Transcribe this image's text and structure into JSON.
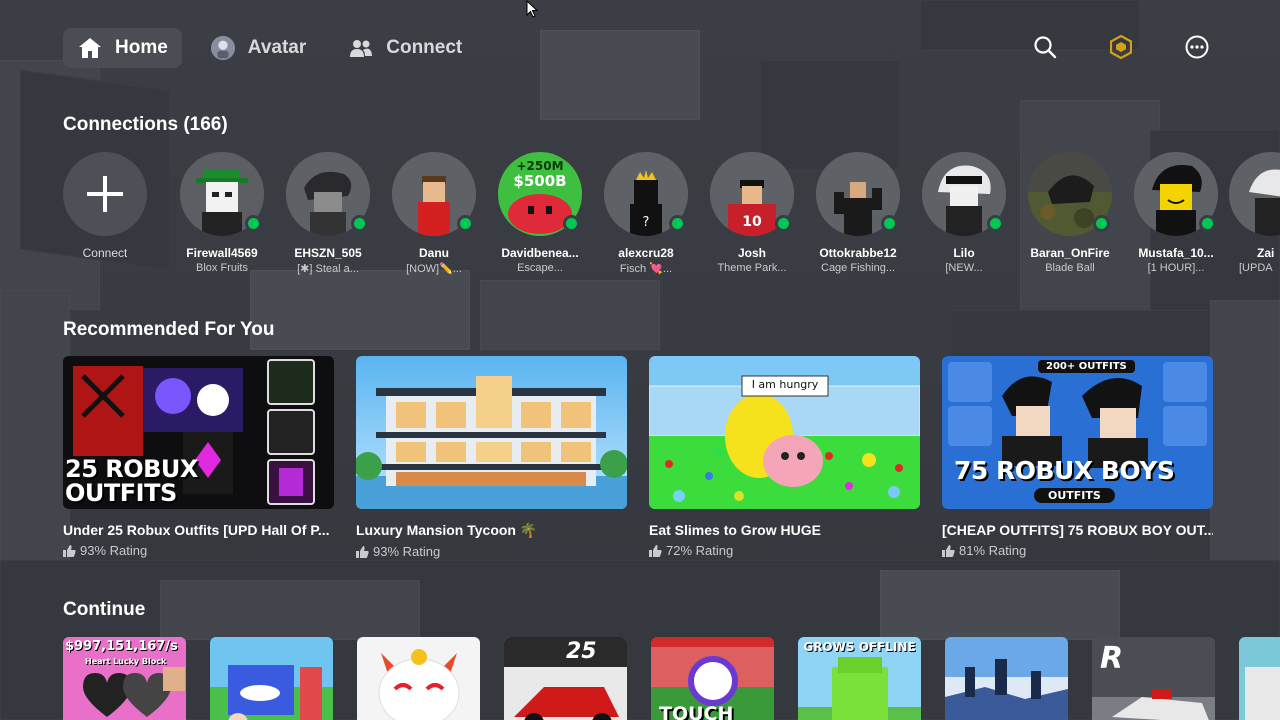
{
  "nav": {
    "items": [
      {
        "label": "Home",
        "icon": "home-icon",
        "active": true
      },
      {
        "label": "Avatar",
        "icon": "avatar-icon",
        "active": false
      },
      {
        "label": "Connect",
        "icon": "people-icon",
        "active": false
      }
    ]
  },
  "top_right_icons": [
    "search-icon",
    "robux-icon",
    "more-icon"
  ],
  "connections": {
    "title": "Connections (166)",
    "add_label": "Connect",
    "people": [
      {
        "name": "Firewall4569",
        "status": "Blox Fruits",
        "online": true
      },
      {
        "name": "EHSZN_505",
        "status": "[✱] Steal a...",
        "online": true
      },
      {
        "name": "Danu",
        "status": "[NOW]✏️...",
        "online": true
      },
      {
        "name": "Davidbenea...",
        "status": "Escape...",
        "online": true
      },
      {
        "name": "alexcru28",
        "status": "Fisch 💘...",
        "online": true
      },
      {
        "name": "Josh",
        "status": "Theme Park...",
        "online": true
      },
      {
        "name": "Ottokrabbe12",
        "status": "Cage Fishing...",
        "online": true
      },
      {
        "name": "Lilo",
        "status": "[NEW...",
        "online": true
      },
      {
        "name": "Baran_OnFire",
        "status": "Blade Ball",
        "online": true
      },
      {
        "name": "Mustafa_10...",
        "status": "[1 HOUR]...",
        "online": true
      },
      {
        "name": "Zai",
        "status": "[UPDA",
        "online": true
      }
    ]
  },
  "recommended": {
    "title": "Recommended For You",
    "games": [
      {
        "title": "Under 25 Robux Outfits [UPD Hall Of P...",
        "rating": "93% Rating",
        "thumb_text": [
          "25 ROBUX",
          "OUTFITS"
        ]
      },
      {
        "title": "Luxury Mansion Tycoon 🌴",
        "rating": "93% Rating",
        "thumb_text": []
      },
      {
        "title": "Eat Slimes to Grow HUGE",
        "rating": "72% Rating",
        "thumb_text": [
          "I am hungry"
        ]
      },
      {
        "title": "[CHEAP OUTFITS] 75 ROBUX BOY OUT...",
        "rating": "81% Rating",
        "thumb_text": [
          "200+ OUTFITS",
          "75 ROBUX BOYS",
          "OUTFITS"
        ]
      }
    ]
  },
  "continue": {
    "title": "Continue",
    "games": [
      {
        "thumb_text": "$997,151,167/s",
        "sub": "Heart Lucky Block"
      },
      {
        "thumb_text": "",
        "sub": ""
      },
      {
        "thumb_text": "",
        "sub": ""
      },
      {
        "thumb_text": "25",
        "sub": ""
      },
      {
        "thumb_text": "TOUCH",
        "sub": ""
      },
      {
        "thumb_text": "GROWS OFFLINE",
        "sub": ""
      },
      {
        "thumb_text": "",
        "sub": ""
      },
      {
        "thumb_text": "R",
        "sub": ""
      },
      {
        "thumb_text": "",
        "sub": ""
      }
    ]
  },
  "colors": {
    "background": "#3a3d43",
    "nav_active": "#4a4d53",
    "online": "#00c853",
    "robux": "#d4a017"
  }
}
